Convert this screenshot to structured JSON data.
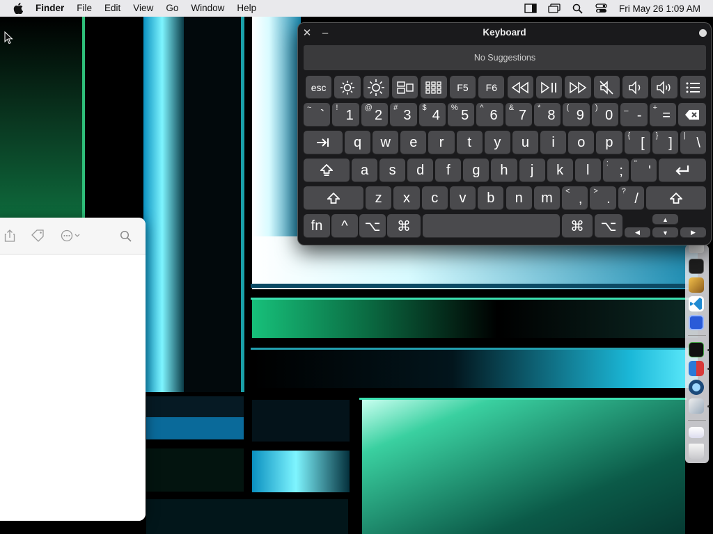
{
  "menubar": {
    "app_name": "Finder",
    "items": [
      "File",
      "Edit",
      "View",
      "Go",
      "Window",
      "Help"
    ],
    "right_icons": [
      "sidebar-icon",
      "windows-icon",
      "search-icon",
      "control-center-icon"
    ],
    "clock": "Fri May 26  1:09 AM"
  },
  "keyboard_viewer": {
    "title": "Keyboard",
    "suggestions": "No Suggestions",
    "function_row": [
      {
        "label": "esc"
      },
      {
        "icon": "brightness-down-icon"
      },
      {
        "icon": "brightness-up-icon"
      },
      {
        "icon": "mission-control-icon"
      },
      {
        "icon": "launchpad-icon"
      },
      {
        "label": "F5"
      },
      {
        "label": "F6"
      },
      {
        "icon": "rewind-icon"
      },
      {
        "icon": "play-pause-icon"
      },
      {
        "icon": "fast-forward-icon"
      },
      {
        "icon": "mute-icon"
      },
      {
        "icon": "volume-down-icon"
      },
      {
        "icon": "volume-up-icon"
      },
      {
        "icon": "list-icon"
      }
    ],
    "number_row": [
      {
        "shift": "~",
        "main": "`"
      },
      {
        "shift": "!",
        "main": "1"
      },
      {
        "shift": "@",
        "main": "2"
      },
      {
        "shift": "#",
        "main": "3"
      },
      {
        "shift": "$",
        "main": "4"
      },
      {
        "shift": "%",
        "main": "5"
      },
      {
        "shift": "^",
        "main": "6"
      },
      {
        "shift": "&",
        "main": "7"
      },
      {
        "shift": "*",
        "main": "8"
      },
      {
        "shift": "(",
        "main": "9"
      },
      {
        "shift": ")",
        "main": "0"
      },
      {
        "shift": "_",
        "main": "-"
      },
      {
        "shift": "+",
        "main": "="
      }
    ],
    "top_row": [
      "q",
      "w",
      "e",
      "r",
      "t",
      "y",
      "u",
      "i",
      "o",
      "p"
    ],
    "top_row_symbols": [
      {
        "shift": "{",
        "main": "["
      },
      {
        "shift": "}",
        "main": "]"
      },
      {
        "shift": "|",
        "main": "\\"
      }
    ],
    "home_row": [
      "a",
      "s",
      "d",
      "f",
      "g",
      "h",
      "j",
      "k",
      "l"
    ],
    "home_row_symbols": [
      {
        "shift": ":",
        "main": ";"
      },
      {
        "shift": "\"",
        "main": "'"
      }
    ],
    "bottom_row": [
      "z",
      "x",
      "c",
      "v",
      "b",
      "n",
      "m"
    ],
    "bottom_row_symbols": [
      {
        "shift": "<",
        "main": ","
      },
      {
        "shift": ">",
        "main": "."
      },
      {
        "shift": "?",
        "main": "/"
      }
    ],
    "modifier_row": {
      "fn": "fn",
      "control": "^",
      "option_left": "⌥",
      "command_left": "⌘",
      "command_right": "⌘",
      "option_right": "⌥",
      "arrow_up": "▲",
      "arrow_left": "◀",
      "arrow_down": "▼",
      "arrow_right": "▶"
    }
  },
  "finder_window": {
    "toolbar_icons": [
      "share-icon",
      "tag-icon",
      "more-actions-icon",
      "search-icon"
    ]
  },
  "dock": {
    "apps": [
      "textedit-icon",
      "terminal-icon",
      "brush-icon",
      "vscode-icon",
      "app-icon",
      "activity-monitor-icon",
      "app-icon",
      "app-icon",
      "script-editor-icon",
      "downloads-icon",
      "trash-icon"
    ]
  }
}
